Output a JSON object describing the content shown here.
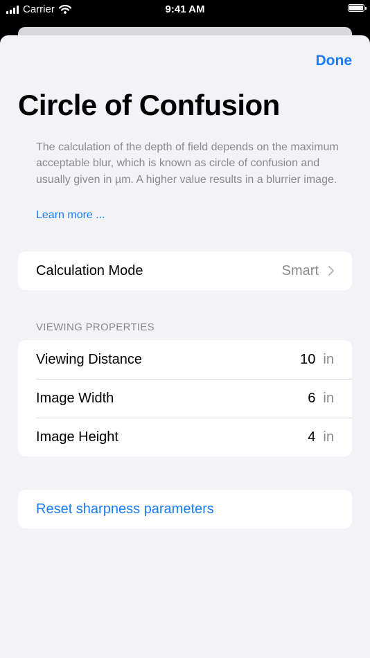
{
  "status_bar": {
    "carrier": "Carrier",
    "time": "9:41 AM"
  },
  "header": {
    "done_label": "Done",
    "title": "Circle of Confusion"
  },
  "description": "The calculation of the depth of field depends on the maximum acceptable blur, which is known as circle of confusion and usually given in µm. A higher value results in a blurrier image.",
  "learn_more": "Learn more ...",
  "calculation_mode": {
    "label": "Calculation Mode",
    "value": "Smart"
  },
  "viewing_properties": {
    "header": "VIEWING PROPERTIES",
    "rows": [
      {
        "label": "Viewing Distance",
        "value": "10",
        "unit": "in"
      },
      {
        "label": "Image Width",
        "value": "6",
        "unit": "in"
      },
      {
        "label": "Image Height",
        "value": "4",
        "unit": "in"
      }
    ]
  },
  "reset_label": "Reset sharpness parameters",
  "colors": {
    "accent": "#1a7df5",
    "background": "#f2f2f7",
    "secondary_text": "#8a8a8e"
  }
}
